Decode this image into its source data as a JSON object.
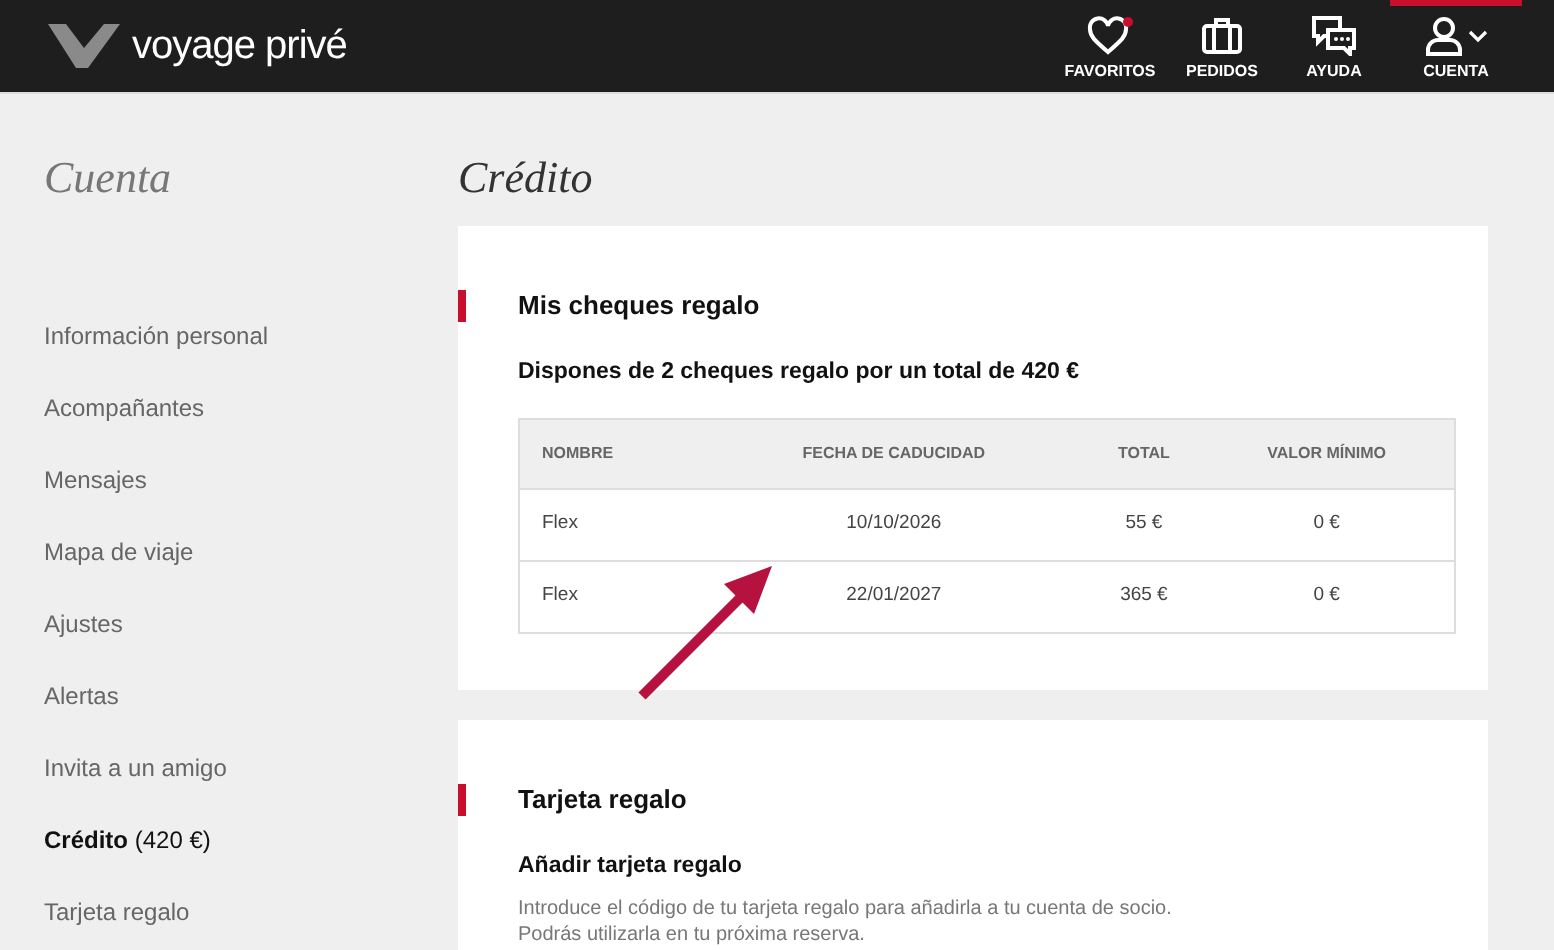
{
  "header": {
    "logo": "voyage privé",
    "nav": [
      {
        "kind": "heart",
        "label": "FAVORITOS",
        "selected": false
      },
      {
        "kind": "suitcase",
        "label": "PEDIDOS",
        "selected": false
      },
      {
        "kind": "chat",
        "label": "AYUDA",
        "selected": false
      },
      {
        "kind": "user",
        "label": "CUENTA",
        "selected": true
      }
    ]
  },
  "sidebar": {
    "title": "Cuenta",
    "items": [
      {
        "label": "Información personal",
        "selected": false
      },
      {
        "label": "Acompañantes",
        "selected": false
      },
      {
        "label": "Mensajes",
        "selected": false
      },
      {
        "label": "Mapa de viaje",
        "selected": false
      },
      {
        "label": "Ajustes",
        "selected": false
      },
      {
        "label": "Alertas",
        "selected": false
      },
      {
        "label": "Invita a un amigo",
        "selected": false
      },
      {
        "label": "Crédito",
        "suffix": "(420 €)",
        "selected": true
      },
      {
        "label": "Tarjeta regalo",
        "selected": false
      }
    ]
  },
  "page_title": "Crédito",
  "cheques": {
    "title": "Mis cheques regalo",
    "summary": "Dispones de 2 cheques regalo por un total de 420 €",
    "columns": [
      "NOMBRE",
      "FECHA DE CADUCIDAD",
      "TOTAL",
      "VALOR MÍNIMO"
    ],
    "rows": [
      [
        "Flex",
        "10/10/2026",
        "55 €",
        "0 €"
      ],
      [
        "Flex",
        "22/01/2027",
        "365 €",
        "0 €"
      ]
    ]
  },
  "gift_card": {
    "title": "Tarjeta regalo",
    "subtitle": "Añadir tarjeta regalo",
    "lines": [
      "Introduce el código de tu tarjeta regalo para añadirla a tu cuenta de socio.",
      "Podrás utilizarla en tu próxima reserva."
    ]
  }
}
